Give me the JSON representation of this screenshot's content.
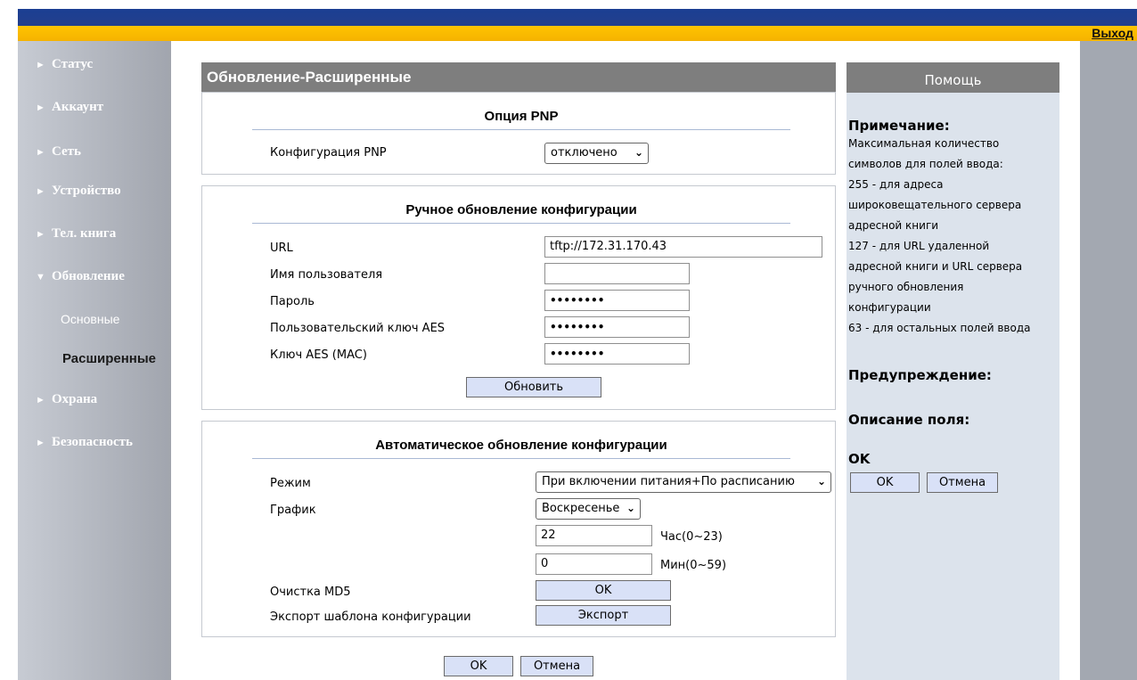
{
  "header": {
    "logout": "Выход"
  },
  "sidebar": {
    "items": [
      {
        "label": "Статус",
        "expanded": false
      },
      {
        "label": "Аккаунт",
        "expanded": false
      },
      {
        "label": "Сеть",
        "expanded": false
      },
      {
        "label": "Устройство",
        "expanded": false
      },
      {
        "label": "Тел. книга",
        "expanded": false
      },
      {
        "label": "Обновление",
        "expanded": true
      },
      {
        "label": "Охрана",
        "expanded": false
      },
      {
        "label": "Безопасность",
        "expanded": false
      }
    ],
    "subitems": [
      {
        "label": "Основные",
        "active": false
      },
      {
        "label": "Расширенные",
        "active": true
      }
    ],
    "arrow_collapsed": "►",
    "arrow_expanded": "▼"
  },
  "main": {
    "title": "Обновление-Расширенные",
    "pnp": {
      "title": "Опция PNP",
      "config_label": "Конфигурация PNP",
      "config_value": "отключено"
    },
    "manual": {
      "title": "Ручное обновление конфигурации",
      "url_label": "URL",
      "url_value": "tftp://172.31.170.43",
      "user_label": "Имя пользователя",
      "user_value": "",
      "password_label": "Пароль",
      "password_value": "••••••••",
      "aes_user_label": "Пользовательский ключ AES",
      "aes_user_value": "••••••••",
      "aes_mac_label": "Ключ AES (MAC)",
      "aes_mac_value": "••••••••",
      "update_button": "Обновить"
    },
    "auto": {
      "title": "Автоматическое обновление конфигурации",
      "mode_label": "Режим",
      "mode_value": "При включении питания+По расписанию",
      "schedule_label": "График",
      "schedule_value": "Воскресенье",
      "hour_value": "22",
      "hour_unit": "Час(0~23)",
      "min_value": "0",
      "min_unit": "Мин(0~59)",
      "md5_label": "Очистка MD5",
      "md5_button": "OK",
      "export_label": "Экспорт шаблона конфигурации",
      "export_button": "Экспорт"
    },
    "ok_button": "OK",
    "cancel_button": "Отмена"
  },
  "help": {
    "title": "Помощь",
    "note_heading": "Примечание:",
    "note_lines": [
      "Максимальная количество",
      "символов для полей ввода:",
      "255 - для адреса",
      "широковещательного сервера",
      "адресной книги",
      "127 - для URL удаленной",
      "адресной книги и URL сервера",
      "ручного обновления",
      "конфигурации",
      "63 - для остальных полей ввода"
    ],
    "warning_heading": "Предупреждение:",
    "field_heading": "Описание поля:",
    "ok_heading": "OK",
    "ok_button": "OK",
    "cancel_button": "Отмена"
  }
}
